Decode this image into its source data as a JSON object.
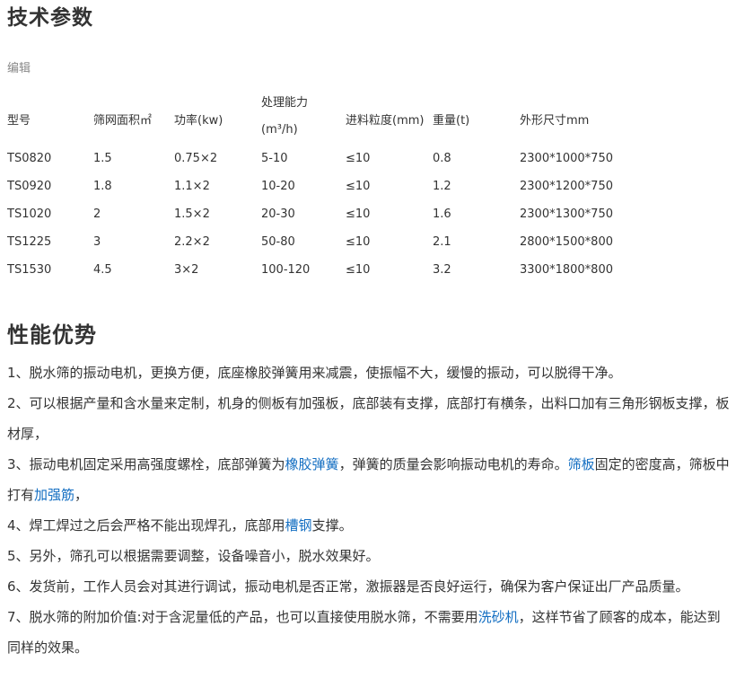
{
  "section1": {
    "title": "技术参数",
    "edit": "编辑"
  },
  "table": {
    "headers": [
      "型号",
      "筛网面积㎡",
      "功率(kw)",
      "处理能力",
      "(m³/h)",
      "进料粒度(mm)",
      "重量(t)",
      "外形尺寸mm"
    ],
    "rows": [
      [
        "TS0820",
        "1.5",
        "0.75×2",
        "5-10",
        "≤10",
        "0.8",
        "2300*1000*750"
      ],
      [
        "TS0920",
        "1.8",
        "1.1×2",
        "10-20",
        "≤10",
        "1.2",
        "2300*1200*750"
      ],
      [
        "TS1020",
        "2",
        "1.5×2",
        "20-30",
        "≤10",
        "1.6",
        "2300*1300*750"
      ],
      [
        "TS1225",
        "3",
        "2.2×2",
        "50-80",
        "≤10",
        "2.1",
        "2800*1500*800"
      ],
      [
        "TS1530",
        "4.5",
        "3×2",
        "100-120",
        "≤10",
        "3.2",
        "3300*1800*800"
      ]
    ]
  },
  "section2": {
    "title": "性能优势",
    "p1": "1、脱水筛的振动电机，更换方便，底座橡胶弹簧用来减震，使振幅不大，缓慢的振动，可以脱得干净。",
    "p2": "2、可以根据产量和含水量来定制，机身的侧板有加强板，底部装有支撑，底部打有横条，出料口加有三角形钢板支撑，板材厚，",
    "p3a": "3、振动电机固定采用高强度螺栓，底部弹簧为",
    "p3link1": "橡胶弹簧",
    "p3b": "，弹簧的质量会影响振动电机的寿命。",
    "p3link2": "筛板",
    "p3c": "固定的密度高，筛板中打有",
    "p3link3": "加强筋",
    "p3d": "，",
    "p4a": "4、焊工焊过之后会严格不能出现焊孔，底部用",
    "p4link": "槽钢",
    "p4b": "支撑。",
    "p5": "5、另外，筛孔可以根据需要调整，设备噪音小，脱水效果好。",
    "p6": "6、发货前，工作人员会对其进行调试，振动电机是否正常，激振器是否良好运行，确保为客户保证出厂产品质量。",
    "p7a": "7、脱水筛的附加价值:对于含泥量低的产品，也可以直接使用脱水筛，不需要用",
    "p7link": "洗砂机",
    "p7b": "，这样节省了顾客的成本，能达到同样的效果。"
  },
  "colors": {
    "link": "#136ec2",
    "text": "#333333",
    "muted": "#888888"
  }
}
